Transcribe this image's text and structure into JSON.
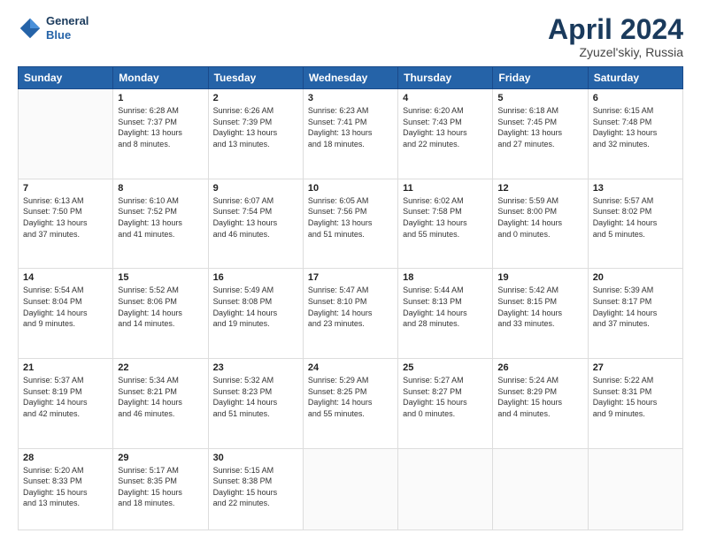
{
  "header": {
    "logo_general": "General",
    "logo_blue": "Blue",
    "month_title": "April 2024",
    "subtitle": "Zyuzel'skiy, Russia"
  },
  "days_of_week": [
    "Sunday",
    "Monday",
    "Tuesday",
    "Wednesday",
    "Thursday",
    "Friday",
    "Saturday"
  ],
  "weeks": [
    [
      {
        "day": "",
        "info": ""
      },
      {
        "day": "1",
        "info": "Sunrise: 6:28 AM\nSunset: 7:37 PM\nDaylight: 13 hours\nand 8 minutes."
      },
      {
        "day": "2",
        "info": "Sunrise: 6:26 AM\nSunset: 7:39 PM\nDaylight: 13 hours\nand 13 minutes."
      },
      {
        "day": "3",
        "info": "Sunrise: 6:23 AM\nSunset: 7:41 PM\nDaylight: 13 hours\nand 18 minutes."
      },
      {
        "day": "4",
        "info": "Sunrise: 6:20 AM\nSunset: 7:43 PM\nDaylight: 13 hours\nand 22 minutes."
      },
      {
        "day": "5",
        "info": "Sunrise: 6:18 AM\nSunset: 7:45 PM\nDaylight: 13 hours\nand 27 minutes."
      },
      {
        "day": "6",
        "info": "Sunrise: 6:15 AM\nSunset: 7:48 PM\nDaylight: 13 hours\nand 32 minutes."
      }
    ],
    [
      {
        "day": "7",
        "info": "Sunrise: 6:13 AM\nSunset: 7:50 PM\nDaylight: 13 hours\nand 37 minutes."
      },
      {
        "day": "8",
        "info": "Sunrise: 6:10 AM\nSunset: 7:52 PM\nDaylight: 13 hours\nand 41 minutes."
      },
      {
        "day": "9",
        "info": "Sunrise: 6:07 AM\nSunset: 7:54 PM\nDaylight: 13 hours\nand 46 minutes."
      },
      {
        "day": "10",
        "info": "Sunrise: 6:05 AM\nSunset: 7:56 PM\nDaylight: 13 hours\nand 51 minutes."
      },
      {
        "day": "11",
        "info": "Sunrise: 6:02 AM\nSunset: 7:58 PM\nDaylight: 13 hours\nand 55 minutes."
      },
      {
        "day": "12",
        "info": "Sunrise: 5:59 AM\nSunset: 8:00 PM\nDaylight: 14 hours\nand 0 minutes."
      },
      {
        "day": "13",
        "info": "Sunrise: 5:57 AM\nSunset: 8:02 PM\nDaylight: 14 hours\nand 5 minutes."
      }
    ],
    [
      {
        "day": "14",
        "info": "Sunrise: 5:54 AM\nSunset: 8:04 PM\nDaylight: 14 hours\nand 9 minutes."
      },
      {
        "day": "15",
        "info": "Sunrise: 5:52 AM\nSunset: 8:06 PM\nDaylight: 14 hours\nand 14 minutes."
      },
      {
        "day": "16",
        "info": "Sunrise: 5:49 AM\nSunset: 8:08 PM\nDaylight: 14 hours\nand 19 minutes."
      },
      {
        "day": "17",
        "info": "Sunrise: 5:47 AM\nSunset: 8:10 PM\nDaylight: 14 hours\nand 23 minutes."
      },
      {
        "day": "18",
        "info": "Sunrise: 5:44 AM\nSunset: 8:13 PM\nDaylight: 14 hours\nand 28 minutes."
      },
      {
        "day": "19",
        "info": "Sunrise: 5:42 AM\nSunset: 8:15 PM\nDaylight: 14 hours\nand 33 minutes."
      },
      {
        "day": "20",
        "info": "Sunrise: 5:39 AM\nSunset: 8:17 PM\nDaylight: 14 hours\nand 37 minutes."
      }
    ],
    [
      {
        "day": "21",
        "info": "Sunrise: 5:37 AM\nSunset: 8:19 PM\nDaylight: 14 hours\nand 42 minutes."
      },
      {
        "day": "22",
        "info": "Sunrise: 5:34 AM\nSunset: 8:21 PM\nDaylight: 14 hours\nand 46 minutes."
      },
      {
        "day": "23",
        "info": "Sunrise: 5:32 AM\nSunset: 8:23 PM\nDaylight: 14 hours\nand 51 minutes."
      },
      {
        "day": "24",
        "info": "Sunrise: 5:29 AM\nSunset: 8:25 PM\nDaylight: 14 hours\nand 55 minutes."
      },
      {
        "day": "25",
        "info": "Sunrise: 5:27 AM\nSunset: 8:27 PM\nDaylight: 15 hours\nand 0 minutes."
      },
      {
        "day": "26",
        "info": "Sunrise: 5:24 AM\nSunset: 8:29 PM\nDaylight: 15 hours\nand 4 minutes."
      },
      {
        "day": "27",
        "info": "Sunrise: 5:22 AM\nSunset: 8:31 PM\nDaylight: 15 hours\nand 9 minutes."
      }
    ],
    [
      {
        "day": "28",
        "info": "Sunrise: 5:20 AM\nSunset: 8:33 PM\nDaylight: 15 hours\nand 13 minutes."
      },
      {
        "day": "29",
        "info": "Sunrise: 5:17 AM\nSunset: 8:35 PM\nDaylight: 15 hours\nand 18 minutes."
      },
      {
        "day": "30",
        "info": "Sunrise: 5:15 AM\nSunset: 8:38 PM\nDaylight: 15 hours\nand 22 minutes."
      },
      {
        "day": "",
        "info": ""
      },
      {
        "day": "",
        "info": ""
      },
      {
        "day": "",
        "info": ""
      },
      {
        "day": "",
        "info": ""
      }
    ]
  ]
}
